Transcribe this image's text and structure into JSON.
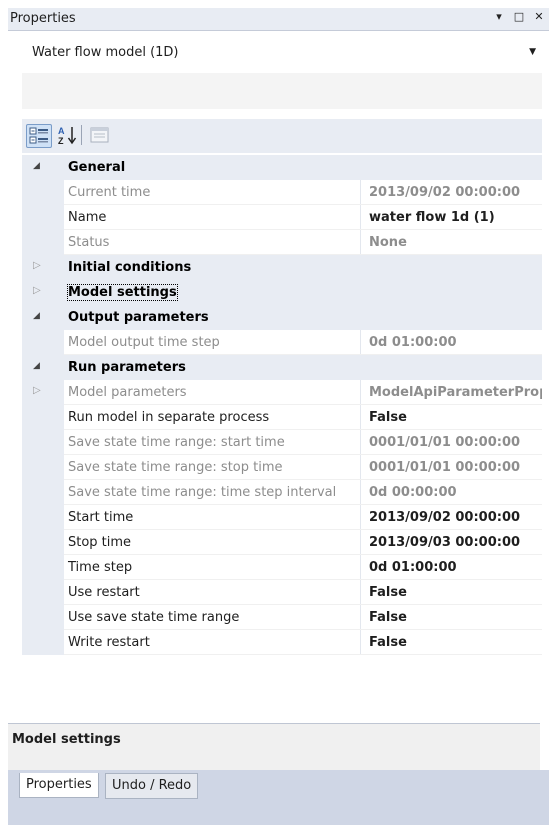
{
  "window": {
    "title": "Properties",
    "buttons": [
      "▾",
      "□",
      "✕"
    ]
  },
  "object_selector": {
    "value": "Water flow model (1D)"
  },
  "toolbar": {
    "icons": [
      "categorized-view-icon",
      "alphabetical-sort-icon",
      "property-pages-icon"
    ]
  },
  "grid": {
    "rows": [
      {
        "type": "category",
        "expanded": true,
        "name": "General"
      },
      {
        "type": "property",
        "readonly": true,
        "name": "Current time",
        "value": "2013/09/02 00:00:00"
      },
      {
        "type": "property",
        "readonly": false,
        "name": "Name",
        "value": "water flow 1d (1)"
      },
      {
        "type": "property",
        "readonly": true,
        "name": "Status",
        "value": "None"
      },
      {
        "type": "category",
        "expanded": false,
        "name": "Initial conditions"
      },
      {
        "type": "category",
        "expanded": false,
        "name": "Model settings"
      },
      {
        "type": "category",
        "expanded": true,
        "name": "Output parameters"
      },
      {
        "type": "property",
        "readonly": true,
        "name": "Model output time step",
        "value": "0d 01:00:00"
      },
      {
        "type": "category",
        "expanded": true,
        "name": "Run parameters"
      },
      {
        "type": "property",
        "readonly": true,
        "expandable": true,
        "name": "Model parameters",
        "value": "ModelApiParameterProp"
      },
      {
        "type": "property",
        "readonly": false,
        "name": "Run model in separate process",
        "value": "False"
      },
      {
        "type": "property",
        "readonly": true,
        "name": "Save state time range: start time",
        "value": "0001/01/01 00:00:00"
      },
      {
        "type": "property",
        "readonly": true,
        "name": "Save state time range: stop time",
        "value": "0001/01/01 00:00:00"
      },
      {
        "type": "property",
        "readonly": true,
        "name": "Save state time range: time step interval",
        "value": "0d 00:00:00"
      },
      {
        "type": "property",
        "readonly": false,
        "name": "Start time",
        "value": "2013/09/02 00:00:00"
      },
      {
        "type": "property",
        "readonly": false,
        "name": "Stop time",
        "value": "2013/09/03 00:00:00"
      },
      {
        "type": "property",
        "readonly": false,
        "name": "Time step",
        "value": "0d 01:00:00"
      },
      {
        "type": "property",
        "readonly": false,
        "name": "Use restart",
        "value": "False"
      },
      {
        "type": "property",
        "readonly": false,
        "name": "Use save state time range",
        "value": "False"
      },
      {
        "type": "property",
        "readonly": false,
        "name": "Write restart",
        "value": "False"
      }
    ]
  },
  "help": {
    "title": "Model settings"
  },
  "tabs": [
    {
      "label": "Properties",
      "active": true
    },
    {
      "label": "Undo / Redo",
      "active": false
    }
  ]
}
